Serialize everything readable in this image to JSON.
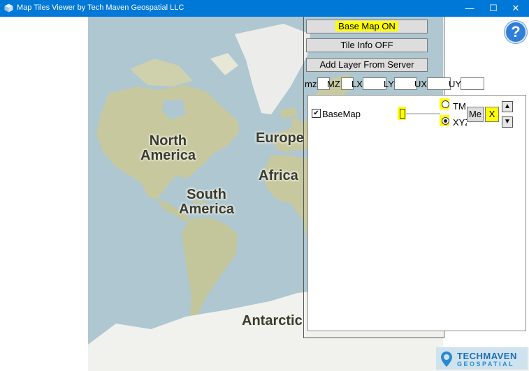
{
  "window": {
    "title": "Map Tiles Viewer by Tech Maven Geospatial LLC",
    "minimize": "—",
    "maximize": "☐",
    "close": "✕"
  },
  "map": {
    "labels": {
      "north_america": "North\nAmerica",
      "south_america": "South\nAmerica",
      "europe": "Europe",
      "africa": "Africa",
      "antarctica": "Antarctic"
    }
  },
  "panel": {
    "base_map_label": "Base Map ON",
    "tile_info_label": "Tile Info OFF",
    "add_layer_label": "Add Layer From Server",
    "bounds": {
      "mz_label": "mz",
      "mz_value": "",
      "MZ_label": "MZ",
      "MZ_value": "",
      "LX_label": "LX",
      "LX_value": "",
      "LY_label": "LY",
      "LY_value": "",
      "UX_label": "UX",
      "UX_value": "",
      "UY_label": "UY",
      "UY_value": ""
    },
    "layers": [
      {
        "name": "BaseMap",
        "checked": true,
        "opacity_slider": 0,
        "scheme_options": [
          "TM",
          "XYZ"
        ],
        "scheme_selected": "XYZ",
        "me_label": "Me",
        "remove_label": "X",
        "up_label": "▲",
        "down_label": "▼"
      }
    ]
  },
  "help_label": "?",
  "logo": {
    "name": "TECHMAVEN",
    "sub": "GEOSPATIAL"
  },
  "colors": {
    "titlebar": "#0078d7",
    "highlight": "#ffff00",
    "ocean": "#aec7d0",
    "land": "#c7c89e",
    "ice": "#f1f1ee"
  }
}
